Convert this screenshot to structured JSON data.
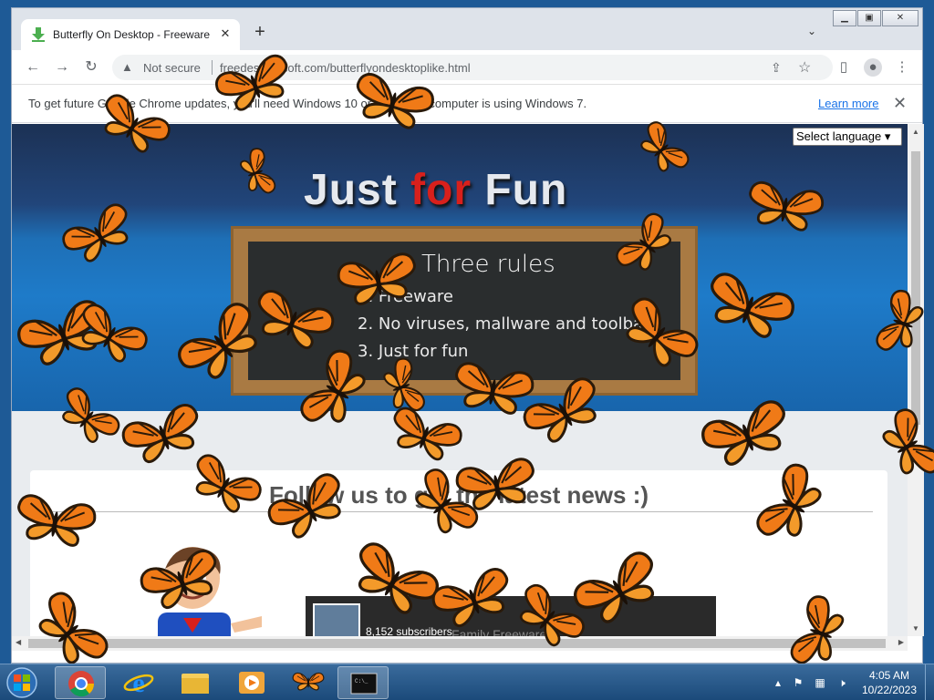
{
  "browser": {
    "tab": {
      "title": "Butterfly On Desktop - Freeware",
      "icon": "download-arrow-icon"
    },
    "new_tab_symbol": "+",
    "omnibox": {
      "security": "Not secure",
      "url": "freedesktopsoft.com/butterflyondesktoplike.html"
    },
    "infobar": {
      "message": "To get future Google Chrome updates, you'll need Windows 10 or later. This computer is using Windows 7.",
      "link": "Learn more"
    }
  },
  "page": {
    "hero_title_part1": "Just ",
    "hero_title_part2": "for",
    "hero_title_part3": " Fun",
    "language_select": "Select language",
    "rules_title": "Three rules",
    "rules": [
      "1. Freeware",
      "2. No viruses, mallware and toolbars",
      "3. Just for fun"
    ],
    "card_heading": "Follow us to get the latest news :)",
    "youtube": {
      "subscribers": "8,152 subscribers",
      "label": "Family Freeware"
    }
  },
  "taskbar": {
    "items": [
      "chrome",
      "internet-explorer",
      "file-explorer",
      "media-player",
      "butterfly-app",
      "command-prompt"
    ],
    "time": "4:05 AM",
    "date": "10/22/2023"
  },
  "colors": {
    "accent_red": "#d8201c",
    "butterfly_orange": "#f07a17",
    "taskbar": "#2b5b8c"
  }
}
